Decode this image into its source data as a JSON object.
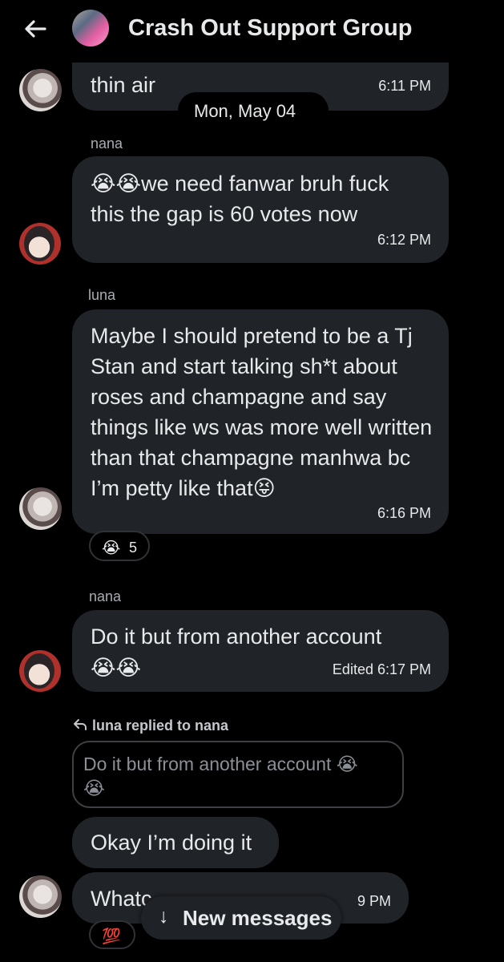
{
  "header": {
    "title": "Crash Out Support Group",
    "back_icon": "arrow-left-icon"
  },
  "date_separator": "Mon, May 04",
  "messages": [
    {
      "text": "thin air",
      "time": "6:11 PM"
    },
    {
      "sender": "nana",
      "emoji": "😭😭",
      "text": "we need fanwar bruh fuck this the gap is 60 votes now",
      "time": "6:12 PM"
    },
    {
      "sender": "luna",
      "text": "Maybe I should pretend to be a Tj Stan and start talking sh*t about roses and champagne and say things like ws was more well written than that champagne manhwa bc I’m petty like that",
      "emoji_end": "😝",
      "time": "6:16 PM",
      "reaction": {
        "emoji": "😭",
        "count": "5"
      }
    },
    {
      "sender": "nana",
      "text": "Do it but from another account",
      "emoji": "😭😭",
      "time": "Edited 6:17 PM"
    },
    {
      "reply_header": "luna replied to nana",
      "quoted_text": "Do it but from another account",
      "quoted_emoji_1": "😭",
      "quoted_emoji_2": "😭"
    },
    {
      "text": "Okay I’m doing it"
    },
    {
      "text": "Whatc",
      "time": "9 PM",
      "reaction": {
        "emoji": "💯"
      }
    }
  ],
  "new_messages_pill": {
    "arrow": "↓",
    "label": "New messages"
  }
}
